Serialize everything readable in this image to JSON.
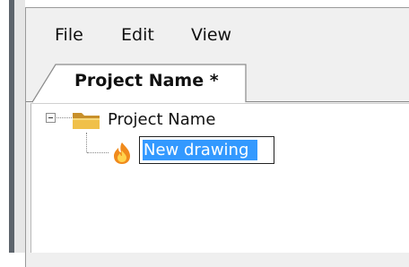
{
  "menu": {
    "file_label": "File",
    "edit_label": "Edit",
    "view_label": "View"
  },
  "tabs": [
    {
      "label": "Project Name *",
      "active": true
    }
  ],
  "tree": {
    "root": {
      "label": "Project Name",
      "icon": "folder-icon",
      "expanded": true,
      "expander_glyph": "minus"
    },
    "children": [
      {
        "label": "New drawing",
        "icon": "flame-icon",
        "editing": true
      }
    ]
  },
  "colors": {
    "selection": "#3399ff",
    "selection_text": "#ffffff",
    "folder": "#e8b73a",
    "panel_background": "#f0f0f0",
    "window_edge": "#5d646c"
  }
}
